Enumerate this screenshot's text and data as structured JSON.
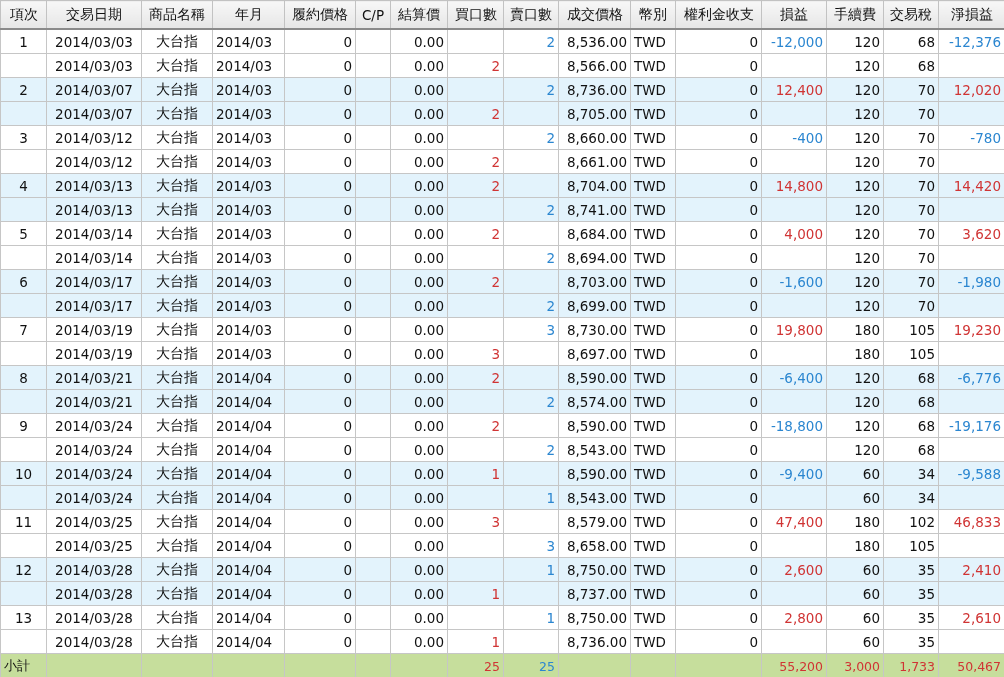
{
  "columns": [
    "項次",
    "交易日期",
    "商品名稱",
    "年月",
    "履約價格",
    "C/P",
    "結算價",
    "買口數",
    "賣口數",
    "成交價格",
    "幣別",
    "權利金收支",
    "損益",
    "手續費",
    "交易稅",
    "淨損益"
  ],
  "rows": [
    {
      "shaded": false,
      "cells": [
        "1",
        "2014/03/03",
        "大台指",
        "2014/03",
        "0",
        null,
        "0.00",
        null,
        {
          "text": "2",
          "color": "#2b86d0"
        },
        "8,536.00",
        "TWD",
        "0",
        {
          "text": "-12,000",
          "color": "#2b86d0"
        },
        "120",
        "68",
        {
          "text": "-12,376",
          "color": "#2b86d0"
        }
      ]
    },
    {
      "shaded": false,
      "cells": [
        null,
        "2014/03/03",
        "大台指",
        "2014/03",
        "0",
        null,
        "0.00",
        {
          "text": "2",
          "color": "#d03434"
        },
        null,
        "8,566.00",
        "TWD",
        "0",
        null,
        "120",
        "68",
        null
      ]
    },
    {
      "shaded": true,
      "cells": [
        "2",
        "2014/03/07",
        "大台指",
        "2014/03",
        "0",
        null,
        "0.00",
        null,
        {
          "text": "2",
          "color": "#2b86d0"
        },
        "8,736.00",
        "TWD",
        "0",
        {
          "text": "12,400",
          "color": "#d03434"
        },
        "120",
        "70",
        {
          "text": "12,020",
          "color": "#d03434"
        }
      ]
    },
    {
      "shaded": true,
      "cells": [
        null,
        "2014/03/07",
        "大台指",
        "2014/03",
        "0",
        null,
        "0.00",
        {
          "text": "2",
          "color": "#d03434"
        },
        null,
        "8,705.00",
        "TWD",
        "0",
        null,
        "120",
        "70",
        null
      ]
    },
    {
      "shaded": false,
      "cells": [
        "3",
        "2014/03/12",
        "大台指",
        "2014/03",
        "0",
        null,
        "0.00",
        null,
        {
          "text": "2",
          "color": "#2b86d0"
        },
        "8,660.00",
        "TWD",
        "0",
        {
          "text": "-400",
          "color": "#2b86d0"
        },
        "120",
        "70",
        {
          "text": "-780",
          "color": "#2b86d0"
        }
      ]
    },
    {
      "shaded": false,
      "cells": [
        null,
        "2014/03/12",
        "大台指",
        "2014/03",
        "0",
        null,
        "0.00",
        {
          "text": "2",
          "color": "#d03434"
        },
        null,
        "8,661.00",
        "TWD",
        "0",
        null,
        "120",
        "70",
        null
      ]
    },
    {
      "shaded": true,
      "cells": [
        "4",
        "2014/03/13",
        "大台指",
        "2014/03",
        "0",
        null,
        "0.00",
        {
          "text": "2",
          "color": "#d03434"
        },
        null,
        "8,704.00",
        "TWD",
        "0",
        {
          "text": "14,800",
          "color": "#d03434"
        },
        "120",
        "70",
        {
          "text": "14,420",
          "color": "#d03434"
        }
      ]
    },
    {
      "shaded": true,
      "cells": [
        null,
        "2014/03/13",
        "大台指",
        "2014/03",
        "0",
        null,
        "0.00",
        null,
        {
          "text": "2",
          "color": "#2b86d0"
        },
        "8,741.00",
        "TWD",
        "0",
        null,
        "120",
        "70",
        null
      ]
    },
    {
      "shaded": false,
      "cells": [
        "5",
        "2014/03/14",
        "大台指",
        "2014/03",
        "0",
        null,
        "0.00",
        {
          "text": "2",
          "color": "#d03434"
        },
        null,
        "8,684.00",
        "TWD",
        "0",
        {
          "text": "4,000",
          "color": "#d03434"
        },
        "120",
        "70",
        {
          "text": "3,620",
          "color": "#d03434"
        }
      ]
    },
    {
      "shaded": false,
      "cells": [
        null,
        "2014/03/14",
        "大台指",
        "2014/03",
        "0",
        null,
        "0.00",
        null,
        {
          "text": "2",
          "color": "#2b86d0"
        },
        "8,694.00",
        "TWD",
        "0",
        null,
        "120",
        "70",
        null
      ]
    },
    {
      "shaded": true,
      "cells": [
        "6",
        "2014/03/17",
        "大台指",
        "2014/03",
        "0",
        null,
        "0.00",
        {
          "text": "2",
          "color": "#d03434"
        },
        null,
        "8,703.00",
        "TWD",
        "0",
        {
          "text": "-1,600",
          "color": "#2b86d0"
        },
        "120",
        "70",
        {
          "text": "-1,980",
          "color": "#2b86d0"
        }
      ]
    },
    {
      "shaded": true,
      "cells": [
        null,
        "2014/03/17",
        "大台指",
        "2014/03",
        "0",
        null,
        "0.00",
        null,
        {
          "text": "2",
          "color": "#2b86d0"
        },
        "8,699.00",
        "TWD",
        "0",
        null,
        "120",
        "70",
        null
      ]
    },
    {
      "shaded": false,
      "cells": [
        "7",
        "2014/03/19",
        "大台指",
        "2014/03",
        "0",
        null,
        "0.00",
        null,
        {
          "text": "3",
          "color": "#2b86d0"
        },
        "8,730.00",
        "TWD",
        "0",
        {
          "text": "19,800",
          "color": "#d03434"
        },
        "180",
        "105",
        {
          "text": "19,230",
          "color": "#d03434"
        }
      ]
    },
    {
      "shaded": false,
      "cells": [
        null,
        "2014/03/19",
        "大台指",
        "2014/03",
        "0",
        null,
        "0.00",
        {
          "text": "3",
          "color": "#d03434"
        },
        null,
        "8,697.00",
        "TWD",
        "0",
        null,
        "180",
        "105",
        null
      ]
    },
    {
      "shaded": true,
      "cells": [
        "8",
        "2014/03/21",
        "大台指",
        "2014/04",
        "0",
        null,
        "0.00",
        {
          "text": "2",
          "color": "#d03434"
        },
        null,
        "8,590.00",
        "TWD",
        "0",
        {
          "text": "-6,400",
          "color": "#2b86d0"
        },
        "120",
        "68",
        {
          "text": "-6,776",
          "color": "#2b86d0"
        }
      ]
    },
    {
      "shaded": true,
      "cells": [
        null,
        "2014/03/21",
        "大台指",
        "2014/04",
        "0",
        null,
        "0.00",
        null,
        {
          "text": "2",
          "color": "#2b86d0"
        },
        "8,574.00",
        "TWD",
        "0",
        null,
        "120",
        "68",
        null
      ]
    },
    {
      "shaded": false,
      "cells": [
        "9",
        "2014/03/24",
        "大台指",
        "2014/04",
        "0",
        null,
        "0.00",
        {
          "text": "2",
          "color": "#d03434"
        },
        null,
        "8,590.00",
        "TWD",
        "0",
        {
          "text": "-18,800",
          "color": "#2b86d0"
        },
        "120",
        "68",
        {
          "text": "-19,176",
          "color": "#2b86d0"
        }
      ]
    },
    {
      "shaded": false,
      "cells": [
        null,
        "2014/03/24",
        "大台指",
        "2014/04",
        "0",
        null,
        "0.00",
        null,
        {
          "text": "2",
          "color": "#2b86d0"
        },
        "8,543.00",
        "TWD",
        "0",
        null,
        "120",
        "68",
        null
      ]
    },
    {
      "shaded": true,
      "cells": [
        "10",
        "2014/03/24",
        "大台指",
        "2014/04",
        "0",
        null,
        "0.00",
        {
          "text": "1",
          "color": "#d03434"
        },
        null,
        "8,590.00",
        "TWD",
        "0",
        {
          "text": "-9,400",
          "color": "#2b86d0"
        },
        "60",
        "34",
        {
          "text": "-9,588",
          "color": "#2b86d0"
        }
      ]
    },
    {
      "shaded": true,
      "cells": [
        null,
        "2014/03/24",
        "大台指",
        "2014/04",
        "0",
        null,
        "0.00",
        null,
        {
          "text": "1",
          "color": "#2b86d0"
        },
        "8,543.00",
        "TWD",
        "0",
        null,
        "60",
        "34",
        null
      ]
    },
    {
      "shaded": false,
      "cells": [
        "11",
        "2014/03/25",
        "大台指",
        "2014/04",
        "0",
        null,
        "0.00",
        {
          "text": "3",
          "color": "#d03434"
        },
        null,
        "8,579.00",
        "TWD",
        "0",
        {
          "text": "47,400",
          "color": "#d03434"
        },
        "180",
        "102",
        {
          "text": "46,833",
          "color": "#d03434"
        }
      ]
    },
    {
      "shaded": false,
      "cells": [
        null,
        "2014/03/25",
        "大台指",
        "2014/04",
        "0",
        null,
        "0.00",
        null,
        {
          "text": "3",
          "color": "#2b86d0"
        },
        "8,658.00",
        "TWD",
        "0",
        null,
        "180",
        "105",
        null
      ]
    },
    {
      "shaded": true,
      "cells": [
        "12",
        "2014/03/28",
        "大台指",
        "2014/04",
        "0",
        null,
        "0.00",
        null,
        {
          "text": "1",
          "color": "#2b86d0"
        },
        "8,750.00",
        "TWD",
        "0",
        {
          "text": "2,600",
          "color": "#d03434"
        },
        "60",
        "35",
        {
          "text": "2,410",
          "color": "#d03434"
        }
      ]
    },
    {
      "shaded": true,
      "cells": [
        null,
        "2014/03/28",
        "大台指",
        "2014/04",
        "0",
        null,
        "0.00",
        {
          "text": "1",
          "color": "#d03434"
        },
        null,
        "8,737.00",
        "TWD",
        "0",
        null,
        "60",
        "35",
        null
      ]
    },
    {
      "shaded": false,
      "cells": [
        "13",
        "2014/03/28",
        "大台指",
        "2014/04",
        "0",
        null,
        "0.00",
        null,
        {
          "text": "1",
          "color": "#2b86d0"
        },
        "8,750.00",
        "TWD",
        "0",
        {
          "text": "2,800",
          "color": "#d03434"
        },
        "60",
        "35",
        {
          "text": "2,610",
          "color": "#d03434"
        }
      ]
    },
    {
      "shaded": false,
      "cells": [
        null,
        "2014/03/28",
        "大台指",
        "2014/04",
        "0",
        null,
        "0.00",
        {
          "text": "1",
          "color": "#d03434"
        },
        null,
        "8,736.00",
        "TWD",
        "0",
        null,
        "60",
        "35",
        null
      ]
    }
  ],
  "subtotal": {
    "cells": [
      "小計",
      null,
      null,
      null,
      null,
      null,
      null,
      {
        "text": "25",
        "color": "#d03434"
      },
      {
        "text": "25",
        "color": "#2b86d0"
      },
      null,
      null,
      null,
      {
        "text": "55,200",
        "color": "#d03434"
      },
      {
        "text": "3,000",
        "color": "#d03434"
      },
      {
        "text": "1,733",
        "color": "#d03434"
      },
      {
        "text": "50,467",
        "color": "#d03434"
      }
    ]
  }
}
